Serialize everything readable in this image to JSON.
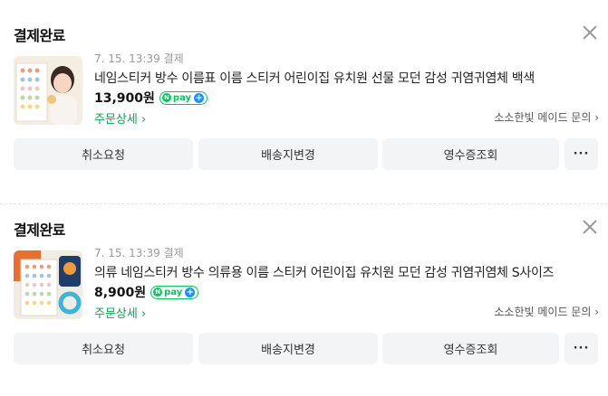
{
  "orders": [
    {
      "status": "결제완료",
      "date": "7. 15. 13:39 결제",
      "title": "네임스티커 방수 이름표 이름 스티커 어린이집 유치원 선물 모던 감성 귀염귀염체 백색",
      "price": "13,900원",
      "pay_badge": "pay",
      "detail_link": "주문상세 ›",
      "seller_link": "소소한빛 메이드 문의 ›",
      "actions": [
        "취소요청",
        "배송지변경",
        "영수증조회"
      ],
      "more_label": "···"
    },
    {
      "status": "결제완료",
      "date": "7. 15. 13:39 결제",
      "title": "의류 네임스티커 방수 의류용 이름 스티커 어린이집 유치원 모던 감성 귀염귀염체 S사이즈",
      "price": "8,900원",
      "pay_badge": "pay",
      "detail_link": "주문상세 ›",
      "seller_link": "소소한빛 메이드 문의 ›",
      "actions": [
        "취소요청",
        "배송지변경",
        "영수증조회"
      ],
      "more_label": "···"
    }
  ],
  "colors": {
    "accent_green": "#03c75a",
    "button_bg": "#f2f4f6"
  },
  "icons": [
    "close-icon",
    "npay-icon",
    "plus-icon"
  ]
}
